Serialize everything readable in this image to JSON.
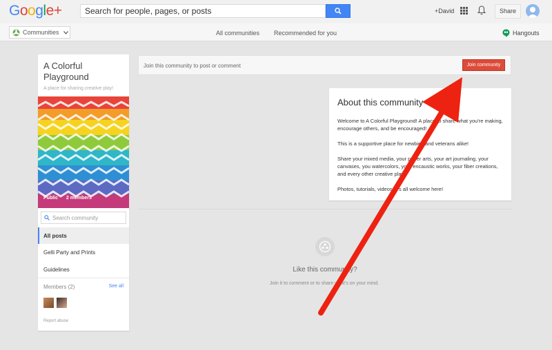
{
  "header": {
    "logo_text": "Google+",
    "search_placeholder": "Search for people, pages, or posts",
    "user_label": "+David",
    "share_label": "Share"
  },
  "subnav": {
    "communities_label": "Communities",
    "links": [
      "All communities",
      "Recommended for you"
    ],
    "hangouts_label": "Hangouts"
  },
  "community": {
    "title": "A Colorful Playground",
    "tagline": "A place for sharing creative play!",
    "visibility": "Public",
    "member_count": "2 members",
    "search_placeholder": "Search community",
    "nav": [
      "All posts",
      "Gelli Party and Prints",
      "Guidelines"
    ],
    "members_label": "Members (2)",
    "see_all": "See all",
    "report": "Report abuse"
  },
  "join": {
    "prompt": "Join this community to post or comment",
    "button": "Join community"
  },
  "about": {
    "heading": "About this community",
    "paragraphs": [
      "Welcome to A Colorful Playground! A place to share what you're making, encourage others, and be encouraged!",
      "This is a supportive place for newbies and veterans alike!",
      "Share your mixed media, your paper arts, your art journaling, your canvases, you watercolors, your encaustic works, your fiber creations, and every other creative play!",
      "Photos, tutorials, videos, it's all welcome here!"
    ]
  },
  "empty_state": {
    "title": "Like this community?",
    "subtitle": "Join it to comment or to share what's on your mind."
  },
  "colors": {
    "accent_blue": "#4285f4",
    "join_red": "#dd4b39",
    "arrow_red": "#ee2211"
  }
}
